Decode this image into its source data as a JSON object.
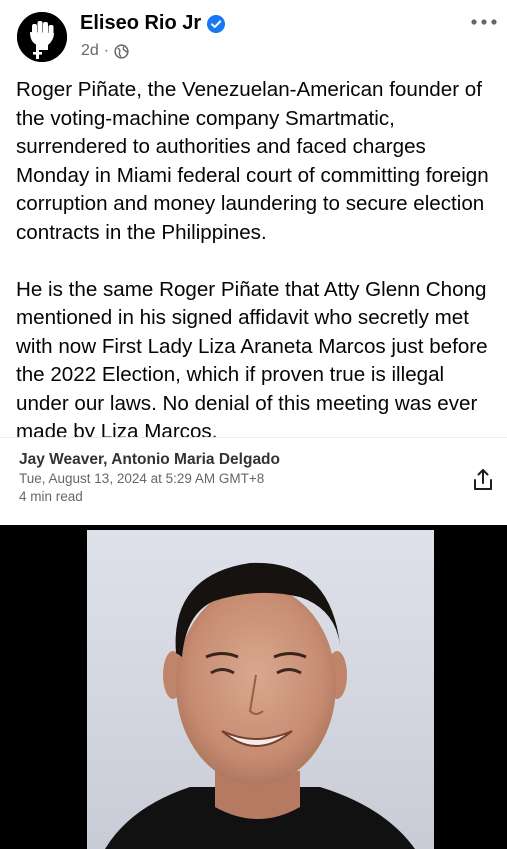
{
  "post": {
    "author": "Eliseo Rio Jr",
    "timestamp": "2d",
    "audience_icon": "globe-icon",
    "paragraphs": [
      "Roger Piñate, the Venezuelan-American founder of the voting-machine company Smartmatic, surrendered to authorities and faced charges Monday in Miami federal court of committing foreign corruption and money laundering to secure election contracts in the Philippines.",
      "He is the same Roger Piñate that Atty Glenn Chong mentioned in his signed affidavit who secretly met with now First Lady Liza Araneta Marcos just before the 2022 Election, which if proven true is  illegal under our laws. No denial of this meeting was ever made by Liza Marcos."
    ]
  },
  "article": {
    "authors": "Jay Weaver, Antonio Maria Delgado",
    "date": "Tue, August 13, 2024 at 5:29 AM GMT+8",
    "read_time": "4 min read"
  },
  "colors": {
    "verified": "#1877f2",
    "meta_text": "#65676b"
  }
}
